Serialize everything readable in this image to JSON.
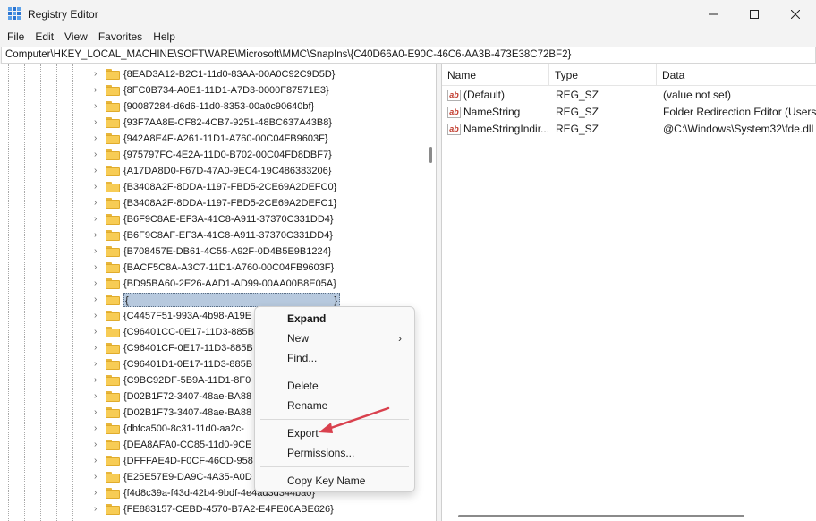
{
  "window": {
    "title": "Registry Editor",
    "minimize_icon": "minimize-icon",
    "maximize_icon": "maximize-icon",
    "close_icon": "close-icon"
  },
  "menu": [
    "File",
    "Edit",
    "View",
    "Favorites",
    "Help"
  ],
  "address": "Computer\\HKEY_LOCAL_MACHINE\\SOFTWARE\\Microsoft\\MMC\\SnapIns\\{C40D66A0-E90C-46C6-AA3B-473E38C72BF2}",
  "tree": {
    "keys": [
      "{8EAD3A12-B2C1-11d0-83AA-00A0C92C9D5D}",
      "{8FC0B734-A0E1-11D1-A7D3-0000F87571E3}",
      "{90087284-d6d6-11d0-8353-00a0c90640bf}",
      "{93F7AA8E-CF82-4CB7-9251-48BC637A43B8}",
      "{942A8E4F-A261-11D1-A760-00C04FB9603F}",
      "{975797FC-4E2A-11D0-B702-00C04FD8DBF7}",
      "{A17DA8D0-F67D-47A0-9EC4-19C486383206}",
      "{B3408A2F-8DDA-1197-FBD5-2CE69A2DEFC0}",
      "{B3408A2F-8DDA-1197-FBD5-2CE69A2DEFC1}",
      "{B6F9C8AE-EF3A-41C8-A911-37370C331DD4}",
      "{B6F9C8AF-EF3A-41C8-A911-37370C331DD4}",
      "{B708457E-DB61-4C55-A92F-0D4B5E9B1224}",
      "{BACF5C8A-A3C7-11D1-A760-00C04FB9603F}",
      "{BD95BA60-2E26-AAD1-AD99-00AA00B8E05A}",
      "{",
      "{C4457F51-993A-4b98-A19E",
      "{C96401CC-0E17-11D3-885B",
      "{C96401CF-0E17-11D3-885B",
      "{C96401D1-0E17-11D3-885B",
      "{C9BC92DF-5B9A-11D1-8F0",
      "{D02B1F72-3407-48ae-BA88",
      "{D02B1F73-3407-48ae-BA88",
      "{dbfca500-8c31-11d0-aa2c-",
      "{DEA8AFA0-CC85-11d0-9CE",
      "{DFFFAE4D-F0CF-46CD-958",
      "{E25E57E9-DA9C-4A35-A0D",
      "{f4d8c39a-f43d-42b4-9bdf-4e4ad3d344ba0}",
      "{FE883157-CEBD-4570-B7A2-E4FE06ABE626}"
    ],
    "selected_index": 14,
    "selected_suffix": "}"
  },
  "values": {
    "columns": [
      "Name",
      "Type",
      "Data"
    ],
    "rows": [
      {
        "name": "(Default)",
        "type": "REG_SZ",
        "data": "(value not set)"
      },
      {
        "name": "NameString",
        "type": "REG_SZ",
        "data": "Folder Redirection Editor (Users)"
      },
      {
        "name": "NameStringIndir...",
        "type": "REG_SZ",
        "data": "@C:\\Windows\\System32\\fde.dll"
      }
    ]
  },
  "context_menu": {
    "items": [
      {
        "label": "Expand",
        "bold": true
      },
      {
        "label": "New",
        "submenu": true
      },
      {
        "label": "Find..."
      },
      {
        "label": "Delete"
      },
      {
        "label": "Rename"
      },
      {
        "label": "Export"
      },
      {
        "label": "Permissions..."
      },
      {
        "label": "Copy Key Name"
      }
    ]
  },
  "colors": {
    "annotation_arrow": "#d9414e",
    "selection": "#b7c9de",
    "folder": "#f7cc55"
  }
}
